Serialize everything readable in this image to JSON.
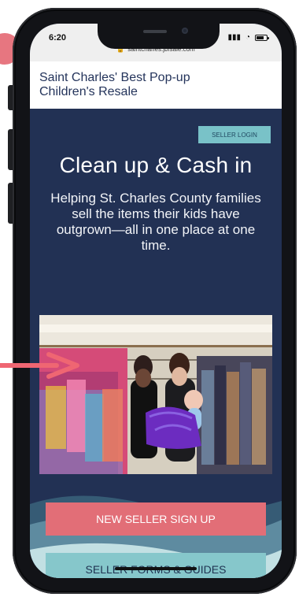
{
  "device": {
    "time": "6:20",
    "url": "saintcharles.jbfsale.com",
    "status_icons": {
      "signal": "signal-icon",
      "wifi": "wifi-icon",
      "battery": "battery-icon",
      "lock": "lock-icon"
    }
  },
  "header": {
    "title": "Saint Charles' Best Pop-up Children's Resale"
  },
  "hero": {
    "login_button": "SELLER LOGIN",
    "title": "Clean up & Cash in",
    "description": "Helping St. Charles County families sell the items their kids have outgrown—all in one place at one time."
  },
  "actions": {
    "new_seller": "NEW SELLER SIGN UP",
    "forms_guides": "SELLER FORMS & GUIDES"
  },
  "colors": {
    "navy": "#223154",
    "pink": "#e26e77",
    "teal": "#86c7cb",
    "header_text": "#24345b"
  }
}
